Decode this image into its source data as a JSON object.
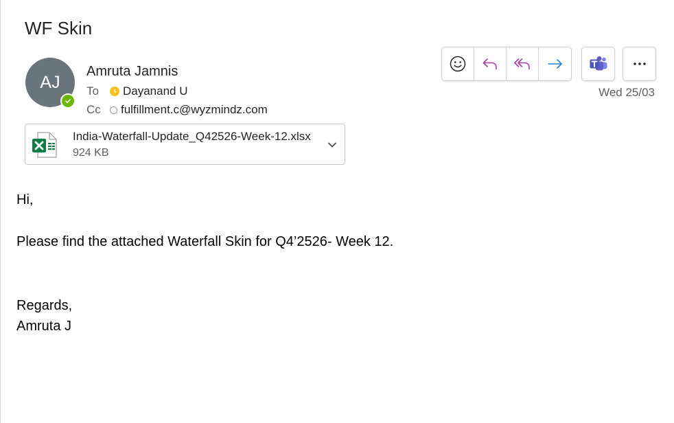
{
  "subject": "WF Skin",
  "sender": {
    "initials": "AJ",
    "name": "Amruta Jamnis",
    "presence": "available"
  },
  "recipients": {
    "to_label": "To",
    "to": [
      {
        "name": "Dayanand U",
        "status": "away"
      }
    ],
    "cc_label": "Cc",
    "cc": [
      {
        "name": "fulfillment.c@wyzmindz.com",
        "status": "unknown"
      }
    ]
  },
  "date": "Wed 25/03",
  "actions": {
    "icons": [
      "smiley-icon",
      "reply-icon",
      "reply-all-icon",
      "forward-icon",
      "teams-icon",
      "more-icon"
    ]
  },
  "attachment": {
    "filename": "India-Waterfall-Update_Q42526-Week-12.xlsx",
    "size": "924 KB",
    "type": "excel"
  },
  "body": {
    "greeting": "Hi,",
    "message": "Please find the attached Waterfall Skin for Q4’2526- Week 12.",
    "closing": "Regards,",
    "signature": "Amruta J"
  },
  "colors": {
    "avatar": "#69757a",
    "presence_available": "#6bb700",
    "presence_away": "#f8c21f",
    "reply_accent": "#a33fa0",
    "forward_accent": "#2a7fd4",
    "teams": "#5b5fc7",
    "excel": "#107c41"
  }
}
